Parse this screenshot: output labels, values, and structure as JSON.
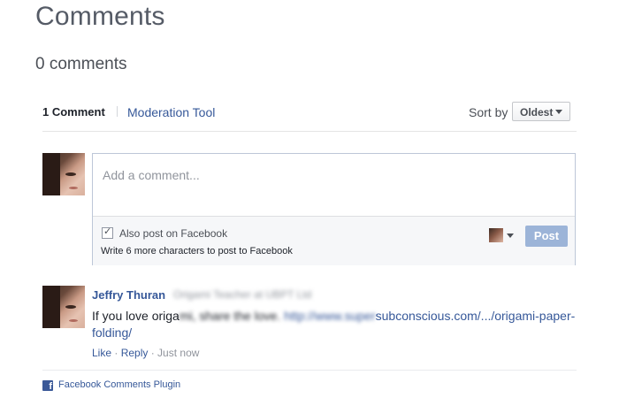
{
  "page": {
    "title": "Comments",
    "comment_count_text": "0 comments"
  },
  "header": {
    "count_tab": "1 Comment",
    "moderation_link": "Moderation Tool",
    "sort_label": "Sort by",
    "sort_selected": "Oldest"
  },
  "composer": {
    "placeholder": "Add a comment...",
    "also_post_label": "Also post on Facebook",
    "also_post_checked": true,
    "char_hint": "Write 6 more characters to post to Facebook",
    "post_button": "Post"
  },
  "comment": {
    "author": "Jeffry Thuran",
    "meta_blurred": "Origami Teacher at UBPT Ltd",
    "text_visible": "If you love origa",
    "text_blurred": "mi, share the love. ",
    "link_blurred": "http://www.super",
    "link_visible": "subconscious.com/.../origami-paper-folding/",
    "actions": {
      "like": "Like",
      "reply": "Reply",
      "separator": " · ",
      "time": "Just now"
    }
  },
  "footer": {
    "plugin_label": "Facebook Comments Plugin",
    "icon": "facebook-icon"
  },
  "colors": {
    "link": "#365899",
    "post_button": "#9cb4d8",
    "facebook_blue": "#3b5998"
  }
}
